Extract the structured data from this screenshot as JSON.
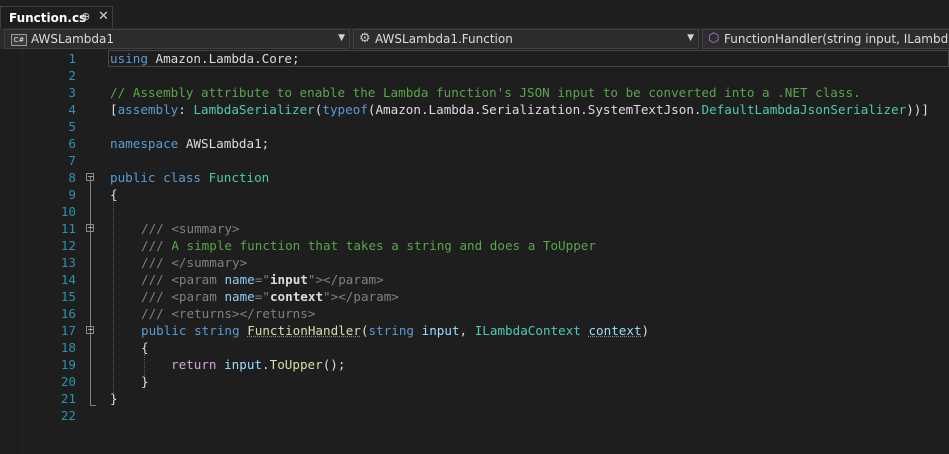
{
  "tab": {
    "title": "Function.cs",
    "pin_glyph": "⊕",
    "close_glyph": "✕"
  },
  "nav": {
    "project": "AWSLambda1",
    "project_icon": "C#",
    "type": "AWSLambda1.Function",
    "member": "FunctionHandler(string input, ILambdaContext context)"
  },
  "editor": {
    "line_numbers": [
      "1",
      "2",
      "3",
      "4",
      "5",
      "6",
      "7",
      "8",
      "9",
      "10",
      "11",
      "12",
      "13",
      "14",
      "15",
      "16",
      "17",
      "18",
      "19",
      "20",
      "21",
      "22"
    ],
    "tokens": {
      "using": "using",
      "using_ns": "Amazon.Lambda.Core",
      "semicolon": ";",
      "comment_assembly": "// Assembly attribute to enable the Lambda function's JSON input to be converted into a .NET class.",
      "lbrack": "[",
      "assembly_kw": "assembly",
      "colon_space": ": ",
      "serializer_attr": "LambdaSerializer",
      "lparen": "(",
      "typeof_kw": "typeof",
      "serializer_ns": "Amazon.Lambda.Serialization.SystemTextJson.",
      "serializer_type": "DefaultLambdaJsonSerializer",
      "attr_close": "))]",
      "namespace_kw": "namespace",
      "namespace_name": " AWSLambda1;",
      "public_kw": "public",
      "class_kw": "class",
      "class_name": "Function",
      "open_brace": "{",
      "close_brace": "}",
      "doc_slashes": "///",
      "summary_open": "<summary>",
      "summary_text": "A simple function that takes a string and does a ToUpper",
      "summary_close": "</summary>",
      "param_open": "<param",
      "name_attr": "name",
      "eq_quote": "=\"",
      "param_input": "input",
      "param_context": "context",
      "quote_gt": "\">",
      "param_close": "</param>",
      "returns_tag": "<returns></returns>",
      "string_kw": "string",
      "method_name": "FunctionHandler",
      "input_param": "input",
      "comma": ", ",
      "context_type": "ILambdaContext",
      "context_param": "context",
      "rparen": ")",
      "return_kw": "return",
      "return_input": "input",
      "dot": ".",
      "to_upper": "ToUpper",
      "call_end": "();"
    }
  }
}
